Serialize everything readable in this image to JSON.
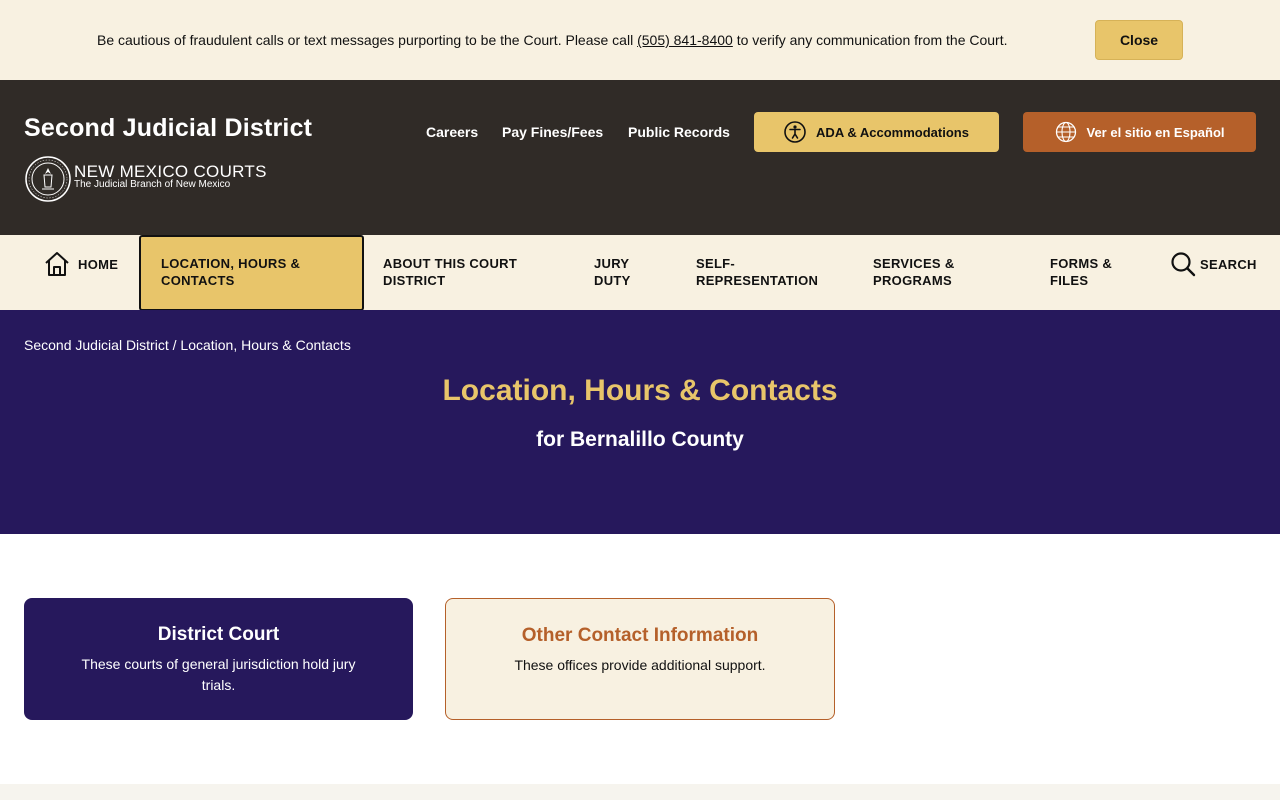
{
  "alert": {
    "text_before": "Be cautious of fraudulent calls or text messages purporting to be the Court. Please call ",
    "phone": "(505) 841-8400",
    "text_after": " to verify any communication from the Court.",
    "close_label": "Close"
  },
  "header": {
    "site_title": "Second Judicial District",
    "logo_title": "NEW MEXICO COURTS",
    "logo_subtitle": "The Judicial Branch of New Mexico",
    "links": [
      "Careers",
      "Pay Fines/Fees",
      "Public Records"
    ],
    "ada_label": "ADA & Accommodations",
    "spanish_label": "Ver el sitio en Español"
  },
  "nav": {
    "home": "HOME",
    "items": [
      {
        "line1": "LOCATION, HOURS &",
        "line2": "CONTACTS",
        "active": true
      },
      {
        "line1": "ABOUT THIS COURT",
        "line2": "DISTRICT"
      },
      {
        "line1": "JURY",
        "line2": "DUTY"
      },
      {
        "line1": "SELF-",
        "line2": "REPRESENTATION"
      },
      {
        "line1": "SERVICES &",
        "line2": "PROGRAMS"
      },
      {
        "line1": "FORMS &",
        "line2": "FILES"
      }
    ],
    "search": "SEARCH"
  },
  "breadcrumb": {
    "root": "Second Judicial District",
    "separator": " / ",
    "current": "Location, Hours & Contacts"
  },
  "hero": {
    "title": "Location, Hours & Contacts",
    "subtitle": "for Bernalillo County"
  },
  "cards": [
    {
      "title": "District Court",
      "desc": "These courts of general jurisdiction hold jury trials."
    },
    {
      "title": "Other Contact Information",
      "desc": "These offices provide additional support."
    }
  ],
  "colors": {
    "navy": "#26185c",
    "gold": "#e8c56a",
    "rust": "#b5602a",
    "cream": "#f8f1e1",
    "header_dark": "#302b27"
  }
}
